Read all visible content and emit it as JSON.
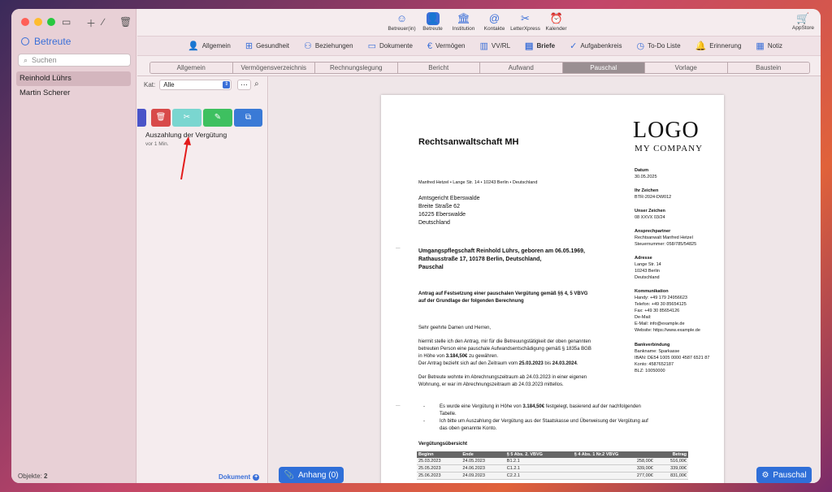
{
  "sidebar": {
    "title": "Betreute",
    "search_placeholder": "Suchen",
    "people": [
      "Reinhold Lührs",
      "Martin Scherer"
    ],
    "objects_label": "Objekte:",
    "objects_count": "2"
  },
  "toolbar": {
    "items": [
      {
        "label": "Betreuer(in)",
        "icon": "person-circle-icon"
      },
      {
        "label": "Betreute",
        "icon": "person-icon"
      },
      {
        "label": "Institution",
        "icon": "building-icon"
      },
      {
        "label": "Kontakte",
        "icon": "at-contact-icon"
      },
      {
        "label": "LetterXpress",
        "icon": "scissors-icon"
      },
      {
        "label": "Kalender",
        "icon": "alarm-clock-icon"
      }
    ],
    "appstore": "AppStore"
  },
  "nav": {
    "items": [
      {
        "label": "Allgemein",
        "icon": "person-icon"
      },
      {
        "label": "Gesundheit",
        "icon": "medkit-icon"
      },
      {
        "label": "Beziehungen",
        "icon": "people-icon"
      },
      {
        "label": "Dokumente",
        "icon": "folder-icon"
      },
      {
        "label": "Vermögen",
        "icon": "euro-icon"
      },
      {
        "label": "VV/RL",
        "icon": "bar-chart-icon"
      },
      {
        "label": "Briefe",
        "icon": "document-icon"
      },
      {
        "label": "Aufgabenkreis",
        "icon": "check-circle-icon"
      },
      {
        "label": "To-Do Liste",
        "icon": "todo-icon"
      },
      {
        "label": "Erinnerung",
        "icon": "bell-icon"
      },
      {
        "label": "Notiz",
        "icon": "note-icon"
      }
    ]
  },
  "tabs": [
    "Allgemein",
    "Vermögensverzeichnis",
    "Rechnungslegung",
    "Bericht",
    "Aufwand",
    "Pauschal",
    "Vorlage",
    "Baustein"
  ],
  "active_tab": "Pauschal",
  "filter": {
    "label": "Kat:",
    "value": "Alle",
    "more": "···"
  },
  "item": {
    "title": "Auszahlung der Vergütung",
    "time": "vor 1 Min."
  },
  "document_button": "Dokument",
  "attach_button": "Anhang (0)",
  "pauschal_button": "Pauschal",
  "letter": {
    "logo_line1": "LOGO",
    "logo_line2": "MY COMPANY",
    "firm": "Rechtsanwaltschaft MH",
    "sender": "Manfred Hetzel • Lange Str. 14 • 10243 Berlin • Deutschland",
    "recipient": [
      "Amtsgericht Eberswalde",
      "Breite Straße 62",
      "16225 Eberswalde",
      "Deutschland"
    ],
    "info": [
      {
        "label": "Datum",
        "lines": [
          "30.05.2025"
        ]
      },
      {
        "label": "Ihr Zeichen",
        "lines": [
          "BTR-2024-DW012"
        ]
      },
      {
        "label": "Unser Zeichen",
        "lines": [
          "08 XXVX 03/24"
        ]
      },
      {
        "label": "Ansprechpartner",
        "lines": [
          "Rechtsanwalt Manfred Hetzel",
          "Steuernummer: 058/785/54825"
        ]
      },
      {
        "label": "Adresse",
        "lines": [
          "Lange Str. 14",
          "10243 Berlin",
          "Deutschland"
        ]
      },
      {
        "label": "Kommunikation",
        "lines": [
          "Handy: +49 179 24956623",
          "Telefon: +49 30 85654125",
          "Fax: +49 30 85654126",
          "De-Mail:",
          "E-Mail: info@example.de",
          "Website: https://www.example.de"
        ]
      },
      {
        "label": "Bankverbindung",
        "lines": [
          "Bankname: Sparkasse",
          "IBAN: DE54 1005 0000 4587 6521 87",
          "Konto: 4587652187",
          "BLZ: 10050000"
        ]
      }
    ],
    "subject": [
      "Umgangspflegschaft Reinhold Lührs, geboren am 06.05.1969,",
      "Rathausstraße 17, 10178 Berlin, Deutschland,",
      "Pauschal"
    ],
    "request": [
      "Antrag auf Festsetzung einer pauschalen Vergütung gemäß §§ 4, 5 VBVG",
      "auf der Grundlage der folgenden Berechnung"
    ],
    "greeting": "Sehr geehrte Damen und Herren,",
    "p1_l1": "hiermit stelle ich den Antrag, mir für die Betreuungstätigkeit der oben genannten",
    "p1_l2": "betreuten Person eine pauschale Aufwandsentschädigung gemäß § 1835a BGB",
    "p1_l3a": "in Höhe von ",
    "p1_amount": "3.184,50€",
    "p1_l3b": " zu gewähren.",
    "p1_l4a": "Der Antrag bezieht sich auf den Zeitraum vom ",
    "p1_from": "25.03.2023",
    "p1_l4b": " bis ",
    "p1_to": "24.03.2024",
    "p2": [
      "Der Betreute wohnte im Abrechnungszeitraum ab 24.03.2023 in einer eigenen",
      "Wohnung, er war im Abrechnungszeitraum ab 24.03.2023 mittellos."
    ],
    "bullet1a": "Es wurde eine Vergütung in Höhe von ",
    "bullet1_amount": "3.184,50€",
    "bullet1b": " festgelegt, basierend auf der nachfolgenden",
    "bullet1c": "Tabelle.",
    "bullet2": [
      "Ich bitte um Auszahlung der Vergütung aus der Staatskasse und Überweisung der Vergütung auf",
      "das oben genannte Konto."
    ],
    "table_title": "Vergütungsübersicht",
    "table_headers": [
      "Beginn",
      "Ende",
      "§ 5 Abs. 2. VBVG",
      "§ 4 Abs. 1 Nr.2 VBVG",
      "Betrag"
    ],
    "table_rows": [
      [
        "25.03.2023",
        "24.05.2023",
        "B1.2.1",
        "258,00€",
        "516,00€"
      ],
      [
        "25.05.2023",
        "24.06.2023",
        "C1.2.1",
        "339,00€",
        "339,00€"
      ],
      [
        "25.06.2023",
        "24.09.2023",
        "C2.2.1",
        "277,00€",
        "831,00€"
      ]
    ]
  }
}
